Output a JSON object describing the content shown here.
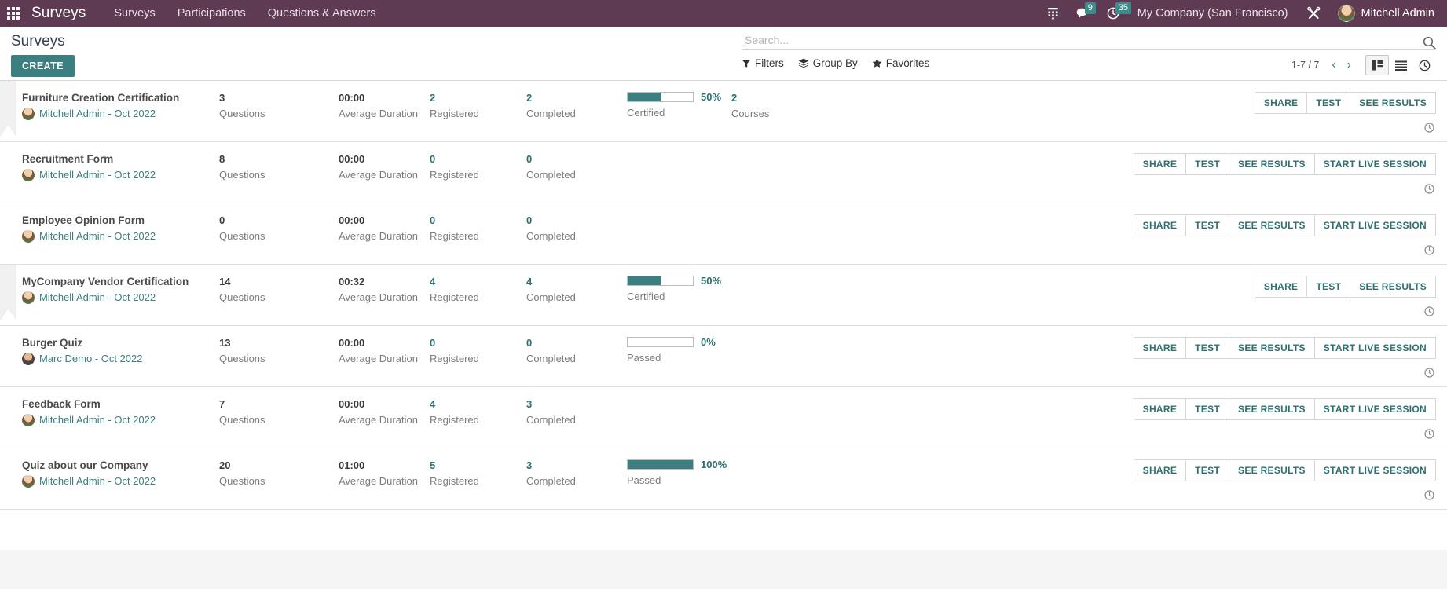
{
  "navbar": {
    "apps_icon": "apps-grid-icon",
    "brand": "Surveys",
    "menu": [
      {
        "label": "Surveys"
      },
      {
        "label": "Participations"
      },
      {
        "label": "Questions & Answers"
      }
    ],
    "systray": [
      {
        "icon": "telephone-keypad-icon",
        "badge": null
      },
      {
        "icon": "messaging-icon",
        "badge": "9"
      },
      {
        "icon": "activity-clock-icon",
        "badge": "35"
      }
    ],
    "company": "My Company (San Francisco)",
    "settings_icon": "tools-icon",
    "user": "Mitchell Admin",
    "avatar_icon": "user-avatar"
  },
  "control_panel": {
    "title": "Surveys",
    "create_label": "CREATE",
    "search": {
      "placeholder": "Search...",
      "value": "",
      "icon": "search-icon"
    },
    "filters": [
      {
        "label": "Filters",
        "icon": "funnel-icon"
      },
      {
        "label": "Group By",
        "icon": "layers-icon"
      },
      {
        "label": "Favorites",
        "icon": "star-icon"
      }
    ],
    "pager": "1-7 / 7",
    "prev_icon": "chevron-left-icon",
    "next_icon": "chevron-right-icon",
    "views": [
      {
        "name": "kanban",
        "icon": "kanban-view-icon",
        "active": true
      },
      {
        "name": "list",
        "icon": "list-view-icon",
        "active": false
      },
      {
        "name": "activity",
        "icon": "activity-view-icon",
        "active": false
      }
    ]
  },
  "labels": {
    "questions": "Questions",
    "average_duration": "Average Duration",
    "registered": "Registered",
    "completed": "Completed",
    "courses": "Courses",
    "clock_icon": "clock-icon"
  },
  "colors": {
    "brand_purple": "#5f3a53",
    "accent_teal": "#3c7f80",
    "link_teal": "#2d7070",
    "badge_teal": "#3c8c8c",
    "muted_gray": "#7c7c7c"
  },
  "rows": [
    {
      "name": "Furniture Creation Certification",
      "author": "Mitchell Admin",
      "date": "Oct 2022",
      "author_line": "Mitchell Admin - Oct 2022",
      "avatar": "mitchell",
      "ribbon": true,
      "questions": "3",
      "duration": "00:00",
      "registered": "2",
      "completed": "2",
      "progress": {
        "percent": "50%",
        "value": 50,
        "label": "Certified"
      },
      "courses": {
        "value": "2",
        "label": "Courses"
      },
      "buttons": [
        "SHARE",
        "TEST",
        "SEE RESULTS"
      ]
    },
    {
      "name": "Recruitment Form",
      "author": "Mitchell Admin",
      "date": "Oct 2022",
      "author_line": "Mitchell Admin - Oct 2022",
      "avatar": "mitchell",
      "ribbon": false,
      "questions": "8",
      "duration": "00:00",
      "registered": "0",
      "completed": "0",
      "progress": null,
      "courses": null,
      "buttons": [
        "SHARE",
        "TEST",
        "SEE RESULTS",
        "START LIVE SESSION"
      ]
    },
    {
      "name": "Employee Opinion Form",
      "author": "Mitchell Admin",
      "date": "Oct 2022",
      "author_line": "Mitchell Admin - Oct 2022",
      "avatar": "mitchell",
      "ribbon": false,
      "questions": "0",
      "duration": "00:00",
      "registered": "0",
      "completed": "0",
      "progress": null,
      "courses": null,
      "buttons": [
        "SHARE",
        "TEST",
        "SEE RESULTS",
        "START LIVE SESSION"
      ]
    },
    {
      "name": "MyCompany Vendor Certification",
      "author": "Mitchell Admin",
      "date": "Oct 2022",
      "author_line": "Mitchell Admin - Oct 2022",
      "avatar": "mitchell",
      "ribbon": true,
      "questions": "14",
      "duration": "00:32",
      "registered": "4",
      "completed": "4",
      "progress": {
        "percent": "50%",
        "value": 50,
        "label": "Certified"
      },
      "courses": null,
      "buttons": [
        "SHARE",
        "TEST",
        "SEE RESULTS"
      ]
    },
    {
      "name": "Burger Quiz",
      "author": "Marc Demo",
      "date": "Oct 2022",
      "author_line": "Marc Demo - Oct 2022",
      "avatar": "marc",
      "ribbon": false,
      "questions": "13",
      "duration": "00:00",
      "registered": "0",
      "completed": "0",
      "progress": {
        "percent": "0%",
        "value": 0,
        "label": "Passed"
      },
      "courses": null,
      "buttons": [
        "SHARE",
        "TEST",
        "SEE RESULTS",
        "START LIVE SESSION"
      ]
    },
    {
      "name": "Feedback Form",
      "author": "Mitchell Admin",
      "date": "Oct 2022",
      "author_line": "Mitchell Admin - Oct 2022",
      "avatar": "mitchell",
      "ribbon": false,
      "questions": "7",
      "duration": "00:00",
      "registered": "4",
      "completed": "3",
      "progress": null,
      "courses": null,
      "buttons": [
        "SHARE",
        "TEST",
        "SEE RESULTS",
        "START LIVE SESSION"
      ]
    },
    {
      "name": "Quiz about our Company",
      "author": "Mitchell Admin",
      "date": "Oct 2022",
      "author_line": "Mitchell Admin - Oct 2022",
      "avatar": "mitchell",
      "ribbon": false,
      "questions": "20",
      "duration": "01:00",
      "registered": "5",
      "completed": "3",
      "progress": {
        "percent": "100%",
        "value": 100,
        "label": "Passed"
      },
      "courses": null,
      "buttons": [
        "SHARE",
        "TEST",
        "SEE RESULTS",
        "START LIVE SESSION"
      ]
    }
  ]
}
